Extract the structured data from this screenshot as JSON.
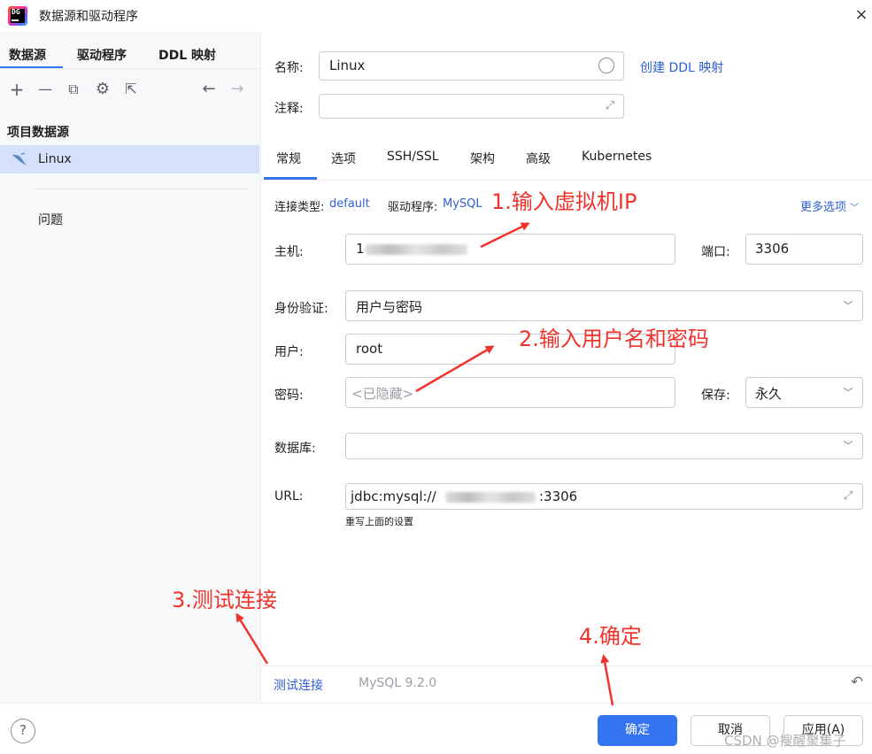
{
  "window": {
    "title": "数据源和驱动程序",
    "close_icon": "×"
  },
  "left_panel": {
    "tabs": [
      {
        "label": "数据源",
        "active": true
      },
      {
        "label": "驱动程序",
        "active": false
      },
      {
        "label": "DDL 映射",
        "active": false
      }
    ],
    "toolbar": {
      "add": "+",
      "remove": "—",
      "copy": "⧉",
      "settings": "⚙",
      "export": "⇱",
      "back": "←",
      "forward": "→"
    },
    "section_title": "项目数据源",
    "datasource": {
      "label": "Linux"
    },
    "problems_label": "问题"
  },
  "form": {
    "name_label": "名称:",
    "name_value": "Linux",
    "create_ddl_link": "创建 DDL 映射",
    "comment_label": "注释:",
    "comment_value": "",
    "tabs": [
      {
        "label": "常规",
        "active": true
      },
      {
        "label": "选项",
        "active": false
      },
      {
        "label": "SSH/SSL",
        "active": false
      },
      {
        "label": "架构",
        "active": false
      },
      {
        "label": "高级",
        "active": false
      },
      {
        "label": "Kubernetes",
        "active": false
      }
    ],
    "connection_type_label": "连接类型:",
    "connection_type_value": "default",
    "driver_label": "驱动程序:",
    "driver_value": "MySQL",
    "more_options": "更多选项",
    "host_label": "主机:",
    "host_prefix": "1",
    "port_label": "端口:",
    "port_value": "3306",
    "auth_label": "身份验证:",
    "auth_value": "用户与密码",
    "user_label": "用户:",
    "user_value": "root",
    "password_label": "密码:",
    "password_placeholder": "<已隐藏>",
    "save_label": "保存:",
    "save_value": "永久",
    "database_label": "数据库:",
    "database_value": "",
    "url_label": "URL:",
    "url_prefix": "jdbc:mysql://",
    "url_suffix": ":3306",
    "url_note": "重写上面的设置"
  },
  "footer": {
    "test_connection": "测试连接",
    "version": "MySQL 9.2.0",
    "help": "?",
    "ok_button": "确定",
    "cancel_button": "取消",
    "apply_button": "应用(A)"
  },
  "annotations": {
    "step1": "1.输入虚拟机IP",
    "step2": "2.输入用户名和密码",
    "step3": "3.测试连接",
    "step4": "4.确定",
    "color": "#f0332b"
  },
  "watermark": "CSDN @搜醒聚集子",
  "colors": {
    "accent": "#3574f0",
    "link": "#2f5fce",
    "selection": "#d5e1fb"
  }
}
